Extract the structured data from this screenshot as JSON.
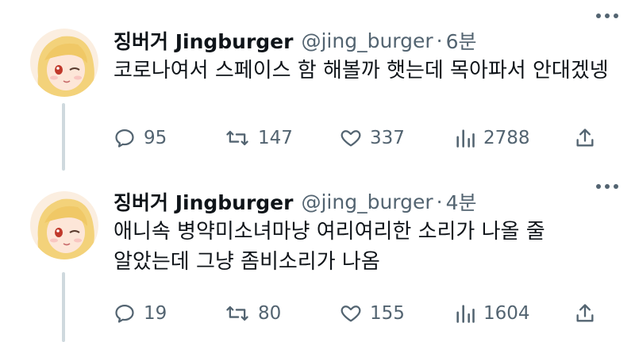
{
  "tweets": [
    {
      "name": "징버거 Jingburger",
      "handle": "@jing_burger",
      "separator": "·",
      "time": "6분",
      "text": "코로나여서 스페이스 함 해볼까 햇는데 목아파서 안대겠넹",
      "replies": "95",
      "retweets": "147",
      "likes": "337",
      "views": "2788"
    },
    {
      "name": "징버거 Jingburger",
      "handle": "@jing_burger",
      "separator": "·",
      "time": "4분",
      "text": "애니속 병약미소녀마냥 여리여리한 소리가 나올 줄 알았는데 그냥 좀비소리가 나옴",
      "replies": "19",
      "retweets": "80",
      "likes": "155",
      "views": "1604"
    }
  ],
  "icons": {
    "avatar": "avatar-image",
    "more": "more-icon",
    "reply": "reply-icon",
    "retweet": "retweet-icon",
    "like": "heart-icon",
    "views": "views-icon",
    "share": "share-icon"
  },
  "colors": {
    "text": "#0f1419",
    "secondary": "#536471",
    "thread_line": "#cfd9de"
  }
}
